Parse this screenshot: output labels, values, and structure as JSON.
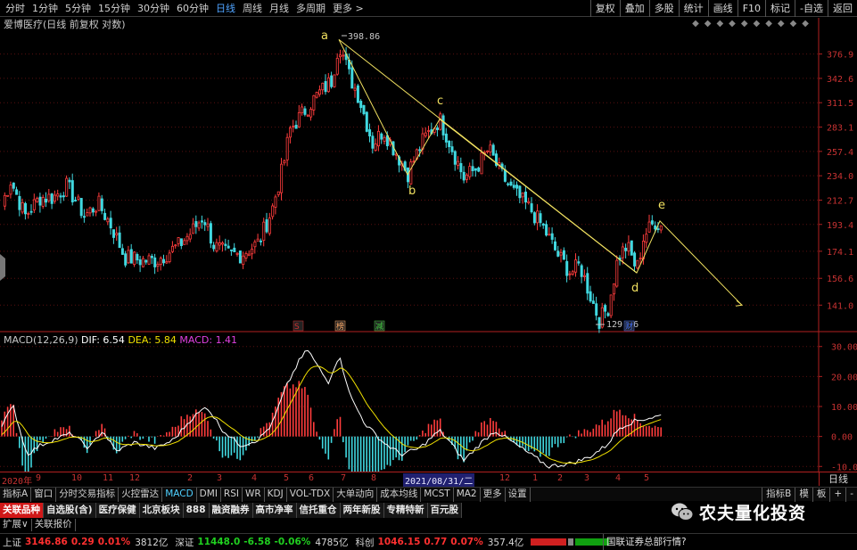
{
  "top_periods": [
    {
      "label": "分时",
      "active": false
    },
    {
      "label": "1分钟",
      "active": false
    },
    {
      "label": "5分钟",
      "active": false
    },
    {
      "label": "15分钟",
      "active": false
    },
    {
      "label": "30分钟",
      "active": false
    },
    {
      "label": "60分钟",
      "active": false
    },
    {
      "label": "日线",
      "active": true
    },
    {
      "label": "周线",
      "active": false
    },
    {
      "label": "月线",
      "active": false
    },
    {
      "label": "多周期",
      "active": false
    },
    {
      "label": "更多 >",
      "active": false
    }
  ],
  "top_tools": [
    "复权",
    "叠加",
    "多股",
    "统计",
    "画线",
    "F10",
    "标记",
    "-自选",
    "返回"
  ],
  "chart_title": "爱博医疗(日线 前复权 对数)",
  "price_axis": [
    "376.9",
    "342.6",
    "311.5",
    "283.1",
    "257.4",
    "234.0",
    "212.7",
    "193.4",
    "174.1",
    "156.6",
    "141.0"
  ],
  "price_high_label": "398.86",
  "price_low_label": "129.76",
  "wave_labels": [
    "a",
    "b",
    "c",
    "d",
    "e"
  ],
  "event_markers": [
    "S",
    "榜",
    "减",
    "财"
  ],
  "macd": {
    "name": "MACD(12,26,9)",
    "dif_label": "DIF: 6.54",
    "dea_label": "DEA: 5.84",
    "macd_label": "MACD: 1.41",
    "axis": [
      "30.00",
      "20.00",
      "10.00",
      "0.00",
      "-10.00"
    ]
  },
  "date_axis": {
    "labels": [
      "2020年",
      "9",
      "10",
      "11",
      "12",
      "2",
      "3",
      "4",
      "5",
      "6",
      "7",
      "8",
      "1",
      "12",
      "1",
      "2",
      "3",
      "4",
      "5"
    ],
    "highlight": "2021/08/31/二",
    "right_label": "日线"
  },
  "indicator_tabs": [
    {
      "label": "指标A",
      "active": false
    },
    {
      "label": "窗口",
      "active": false
    },
    {
      "label": "分时交易指标",
      "active": false
    },
    {
      "label": "火控雷达",
      "active": false
    },
    {
      "label": "MACD",
      "active": true
    },
    {
      "label": "DMI",
      "active": false
    },
    {
      "label": "RSI",
      "active": false
    },
    {
      "label": "WR",
      "active": false
    },
    {
      "label": "KDJ",
      "active": false
    },
    {
      "label": "VOL-TDX",
      "active": false
    },
    {
      "label": "大单动向",
      "active": false
    },
    {
      "label": "成本均线",
      "active": false
    },
    {
      "label": "MCST",
      "active": false
    },
    {
      "label": "MA2",
      "active": false
    },
    {
      "label": "更多",
      "active": false
    },
    {
      "label": "设置",
      "active": false
    }
  ],
  "indicator_right": [
    "指标B",
    "模",
    "板",
    "+",
    "-"
  ],
  "sector_tabs": [
    {
      "label": "关联品种",
      "active": true
    },
    {
      "label": "自选股(含)",
      "active": false
    },
    {
      "label": "医疗保健",
      "active": false
    },
    {
      "label": "北京板块",
      "active": false
    },
    {
      "label": "888",
      "active": false
    },
    {
      "label": "融资融券",
      "active": false
    },
    {
      "label": "高市净率",
      "active": false
    },
    {
      "label": "信托重仓",
      "active": false
    },
    {
      "label": "两年新股",
      "active": false
    },
    {
      "label": "专精特新",
      "active": false
    },
    {
      "label": "百元股",
      "active": false
    }
  ],
  "ext_tabs": [
    "扩展∨",
    "关联报价"
  ],
  "status": {
    "sh_label": "上证",
    "sh_price": "3146.86",
    "sh_chg": "0.29",
    "sh_pct": "0.01%",
    "sh_amt": "3812亿",
    "sz_label": "深证",
    "sz_price": "11448.0",
    "sz_chg": "-6.58",
    "sz_pct": "-0.06%",
    "sz_amt": "4785亿",
    "kc_label": "科创",
    "kc_price": "1046.15",
    "kc_chg": "0.77",
    "kc_pct": "0.07%",
    "kc_amt": "357.4亿",
    "news": "国联证券总部行情?"
  },
  "watermark": "农夫量化投资",
  "colors": {
    "up": "#ff3c3c",
    "down": "#40d8e0",
    "axis": "#b02020",
    "wave": "#f0e060",
    "dif": "#ffffff",
    "dea": "#f0e000"
  },
  "chart_data": {
    "type": "candlestick",
    "symbol": "爱博医疗",
    "period": "日线",
    "scale": "log",
    "ylim": [
      129.76,
      398.86
    ],
    "y_ticks": [
      376.9,
      342.6,
      311.5,
      283.1,
      257.4,
      234.0,
      212.7,
      193.4,
      174.1,
      156.6,
      141.0
    ],
    "high": 398.86,
    "low": 129.76,
    "waves": [
      {
        "label": "a",
        "price": 398.86
      },
      {
        "label": "b",
        "price": 235
      },
      {
        "label": "c",
        "price": 292
      },
      {
        "label": "d",
        "price": 160
      },
      {
        "label": "e",
        "price": 196
      }
    ],
    "macd": {
      "dif": 6.54,
      "dea": 5.84,
      "macd": 1.41,
      "ylim": [
        -12,
        32
      ]
    }
  }
}
